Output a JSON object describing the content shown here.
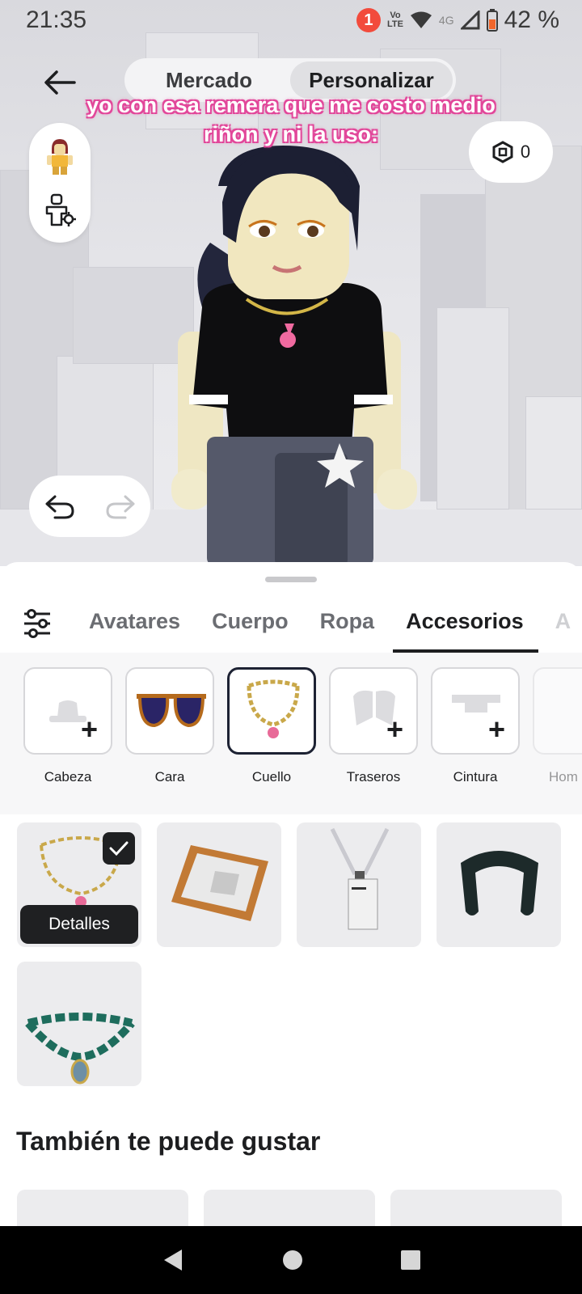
{
  "status_bar": {
    "time": "21:35",
    "notification_count": "1",
    "volte_line1": "Vo",
    "volte_line2": "LTE",
    "network": "4G",
    "battery": "42 %"
  },
  "top_nav": {
    "tabs": [
      {
        "label": "Mercado",
        "active": false
      },
      {
        "label": "Personalizar",
        "active": true
      }
    ]
  },
  "overlay_caption": {
    "line1": "yo con esa remera que me costo medio",
    "line2": "riñon y ni la uso:"
  },
  "robux": {
    "amount": "0"
  },
  "category_tabs": [
    {
      "label": "Avatares",
      "active": false
    },
    {
      "label": "Cuerpo",
      "active": false
    },
    {
      "label": "Ropa",
      "active": false
    },
    {
      "label": "Accesorios",
      "active": true
    },
    {
      "label": "A",
      "active": false
    }
  ],
  "subcategories": [
    {
      "label": "Cabeza",
      "state": "empty"
    },
    {
      "label": "Cara",
      "state": "equipped"
    },
    {
      "label": "Cuello",
      "state": "selected"
    },
    {
      "label": "Traseros",
      "state": "empty"
    },
    {
      "label": "Cintura",
      "state": "empty"
    },
    {
      "label": "Hom",
      "state": "empty"
    }
  ],
  "items": {
    "details_label": "Detalles"
  },
  "recommendations": {
    "title": "También te puede gustar"
  },
  "colors": {
    "accent_dark": "#1d1e20",
    "notification": "#f24b3c",
    "caption_outline": "#e2479a"
  }
}
